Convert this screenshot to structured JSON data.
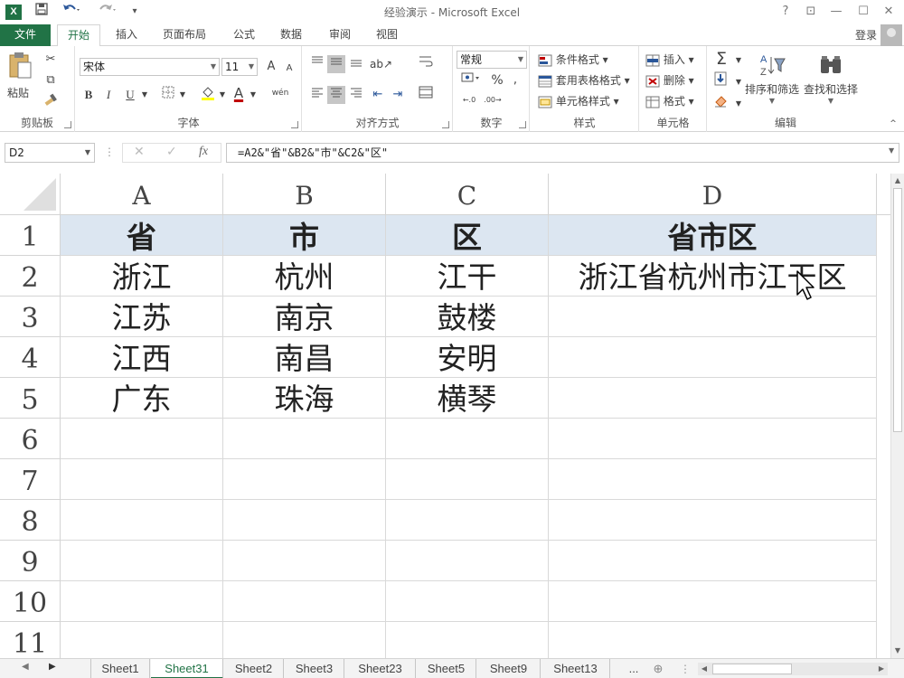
{
  "window": {
    "title": "经验演示 - Microsoft Excel",
    "app_icon": "X",
    "help": "?",
    "restore_ribbon": "⊡",
    "minimize": "—",
    "maximize": "☐",
    "close": "✕"
  },
  "qat": {
    "save_icon": "save-icon",
    "undo_icon": "undo-icon",
    "redo_icon": "redo-icon"
  },
  "tabs": {
    "file": "文件",
    "items": [
      "开始",
      "插入",
      "页面布局",
      "公式",
      "数据",
      "审阅",
      "视图"
    ],
    "active": "开始",
    "login": "登录"
  },
  "ribbon": {
    "clipboard": {
      "label": "剪贴板",
      "paste": "粘贴"
    },
    "font": {
      "label": "字体",
      "name": "宋体",
      "size": "11",
      "bold": "B",
      "italic": "I",
      "underline": "U",
      "grow": "A",
      "shrink": "A",
      "font_color": "A",
      "phonetic": "wén"
    },
    "alignment": {
      "label": "对齐方式"
    },
    "number": {
      "label": "数字",
      "format": "常规",
      "percent": "%"
    },
    "styles": {
      "label": "样式",
      "conditional": "条件格式",
      "table": "套用表格格式",
      "cell_styles": "单元格样式"
    },
    "cells": {
      "label": "单元格",
      "insert": "插入",
      "delete": "删除",
      "format": "格式"
    },
    "editing": {
      "label": "编辑",
      "sum": "Σ",
      "sort_filter": "排序和筛选",
      "find_select": "查找和选择"
    }
  },
  "formula_bar": {
    "name_box": "D2",
    "cancel": "✕",
    "enter": "✓",
    "fx": "fx",
    "formula": "=A2&\"省\"&B2&\"市\"&C2&\"区\""
  },
  "grid": {
    "columns": [
      "A",
      "B",
      "C",
      "D"
    ],
    "rows": [
      "1",
      "2",
      "3",
      "4",
      "5",
      "6",
      "7",
      "8",
      "9",
      "10",
      "11"
    ],
    "cells": [
      [
        "省",
        "市",
        "区",
        "省市区"
      ],
      [
        "浙江",
        "杭州",
        "江干",
        "浙江省杭州市江干区"
      ],
      [
        "江苏",
        "南京",
        "鼓楼",
        ""
      ],
      [
        "江西",
        "南昌",
        "安明",
        ""
      ],
      [
        "广东",
        "珠海",
        "横琴",
        ""
      ]
    ],
    "header_fill": "#dce6f1"
  },
  "sheets": {
    "tabs": [
      "Sheet1",
      "Sheet31",
      "Sheet2",
      "Sheet3",
      "Sheet23",
      "Sheet5",
      "Sheet9",
      "Sheet13"
    ],
    "active": "Sheet31",
    "more": "...",
    "add": "⊕"
  },
  "colors": {
    "accent": "#217346",
    "header_fill": "#dce6f1"
  }
}
